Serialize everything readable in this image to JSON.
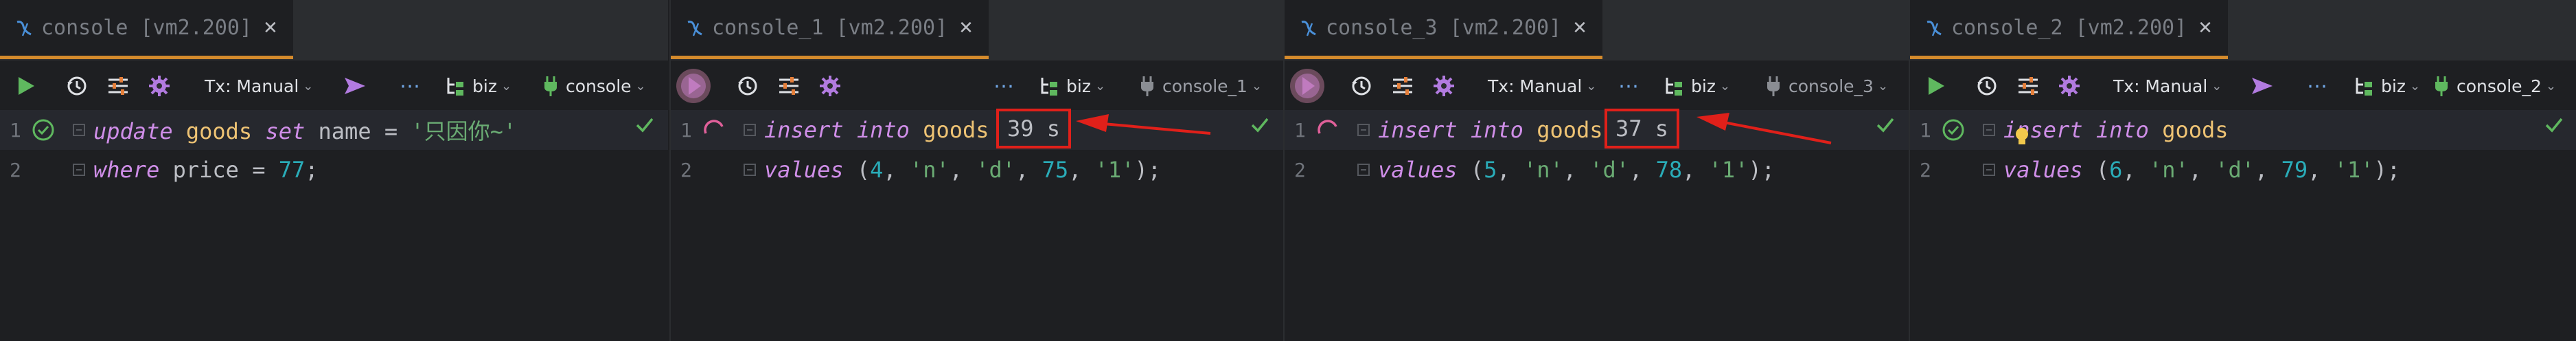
{
  "panes": [
    {
      "tab_title": "console [vm2.200]",
      "tx_label": "Tx: Manual",
      "schema": "biz",
      "session": "console",
      "running": false,
      "lines": [
        {
          "num": "1",
          "tokens": [
            {
              "t": "update",
              "c": "kw"
            },
            {
              "t": " ",
              "c": "txt"
            },
            {
              "t": "goods",
              "c": "id"
            },
            {
              "t": " ",
              "c": "txt"
            },
            {
              "t": "set",
              "c": "kw"
            },
            {
              "t": " name = ",
              "c": "txt"
            },
            {
              "t": "'只因你~'",
              "c": "str"
            }
          ]
        },
        {
          "num": "2",
          "tokens": [
            {
              "t": "where",
              "c": "kw"
            },
            {
              "t": " price = ",
              "c": "txt"
            },
            {
              "t": "77",
              "c": "num"
            },
            {
              "t": ";",
              "c": "txt"
            }
          ]
        }
      ],
      "elapsed": ""
    },
    {
      "tab_title": "console_1 [vm2.200]",
      "tx_label": "",
      "schema": "biz",
      "session": "console_1",
      "running": true,
      "lines": [
        {
          "num": "1",
          "tokens": [
            {
              "t": "insert",
              "c": "kw"
            },
            {
              "t": " ",
              "c": "txt"
            },
            {
              "t": "into",
              "c": "kw"
            },
            {
              "t": " ",
              "c": "txt"
            },
            {
              "t": "goods",
              "c": "id"
            }
          ]
        },
        {
          "num": "2",
          "tokens": [
            {
              "t": "values",
              "c": "kw"
            },
            {
              "t": " (",
              "c": "txt"
            },
            {
              "t": "4",
              "c": "num"
            },
            {
              "t": ", ",
              "c": "txt"
            },
            {
              "t": "'n'",
              "c": "str"
            },
            {
              "t": ", ",
              "c": "txt"
            },
            {
              "t": "'d'",
              "c": "str"
            },
            {
              "t": ", ",
              "c": "txt"
            },
            {
              "t": "75",
              "c": "num"
            },
            {
              "t": ", ",
              "c": "txt"
            },
            {
              "t": "'1'",
              "c": "str"
            },
            {
              "t": ");",
              "c": "txt"
            }
          ]
        }
      ],
      "elapsed": "39 s"
    },
    {
      "tab_title": "console_3 [vm2.200]",
      "tx_label": "Tx: Manual",
      "schema": "biz",
      "session": "console_3",
      "running": true,
      "lines": [
        {
          "num": "1",
          "tokens": [
            {
              "t": "insert",
              "c": "kw"
            },
            {
              "t": " ",
              "c": "txt"
            },
            {
              "t": "into",
              "c": "kw"
            },
            {
              "t": " ",
              "c": "txt"
            },
            {
              "t": "goods",
              "c": "id"
            }
          ]
        },
        {
          "num": "2",
          "tokens": [
            {
              "t": "values",
              "c": "kw"
            },
            {
              "t": " (",
              "c": "txt"
            },
            {
              "t": "5",
              "c": "num"
            },
            {
              "t": ", ",
              "c": "txt"
            },
            {
              "t": "'n'",
              "c": "str"
            },
            {
              "t": ", ",
              "c": "txt"
            },
            {
              "t": "'d'",
              "c": "str"
            },
            {
              "t": ", ",
              "c": "txt"
            },
            {
              "t": "78",
              "c": "num"
            },
            {
              "t": ", ",
              "c": "txt"
            },
            {
              "t": "'1'",
              "c": "str"
            },
            {
              "t": ");",
              "c": "txt"
            }
          ]
        }
      ],
      "elapsed": "37 s"
    },
    {
      "tab_title": "console_2 [vm2.200]",
      "tx_label": "Tx: Manual",
      "schema": "biz",
      "session": "console_2",
      "running": false,
      "lines": [
        {
          "num": "1",
          "tokens": [
            {
              "t": "insert",
              "c": "kw"
            },
            {
              "t": " ",
              "c": "txt"
            },
            {
              "t": "into",
              "c": "kw"
            },
            {
              "t": " ",
              "c": "txt"
            },
            {
              "t": "goods",
              "c": "id"
            }
          ]
        },
        {
          "num": "2",
          "tokens": [
            {
              "t": "values",
              "c": "kw"
            },
            {
              "t": " (",
              "c": "txt"
            },
            {
              "t": "6",
              "c": "num"
            },
            {
              "t": ", ",
              "c": "txt"
            },
            {
              "t": "'n'",
              "c": "str"
            },
            {
              "t": ", ",
              "c": "txt"
            },
            {
              "t": "'d'",
              "c": "str"
            },
            {
              "t": ", ",
              "c": "txt"
            },
            {
              "t": "79",
              "c": "num"
            },
            {
              "t": ", ",
              "c": "txt"
            },
            {
              "t": "'1'",
              "c": "str"
            },
            {
              "t": ");",
              "c": "txt"
            }
          ]
        }
      ],
      "elapsed": ""
    }
  ],
  "colors": {
    "background": "#1e1f22",
    "tab_accent": "#d48a2c",
    "keyword": "#cf8ee8",
    "identifier": "#eec374",
    "string": "#6aab73",
    "number": "#2aacb8",
    "run_green": "#5fb85f",
    "annotation_red": "#e0201a"
  },
  "icons": [
    "database-icon",
    "close-icon",
    "run-icon",
    "running-stop-icon",
    "history-icon",
    "settings-sliders-icon",
    "gear-icon",
    "send-icon",
    "more-icon",
    "schema-icon",
    "plug-icon",
    "check-circle-icon",
    "spinner-icon",
    "checkmark-icon",
    "bulb-icon",
    "fold-icon",
    "red-arrow"
  ]
}
